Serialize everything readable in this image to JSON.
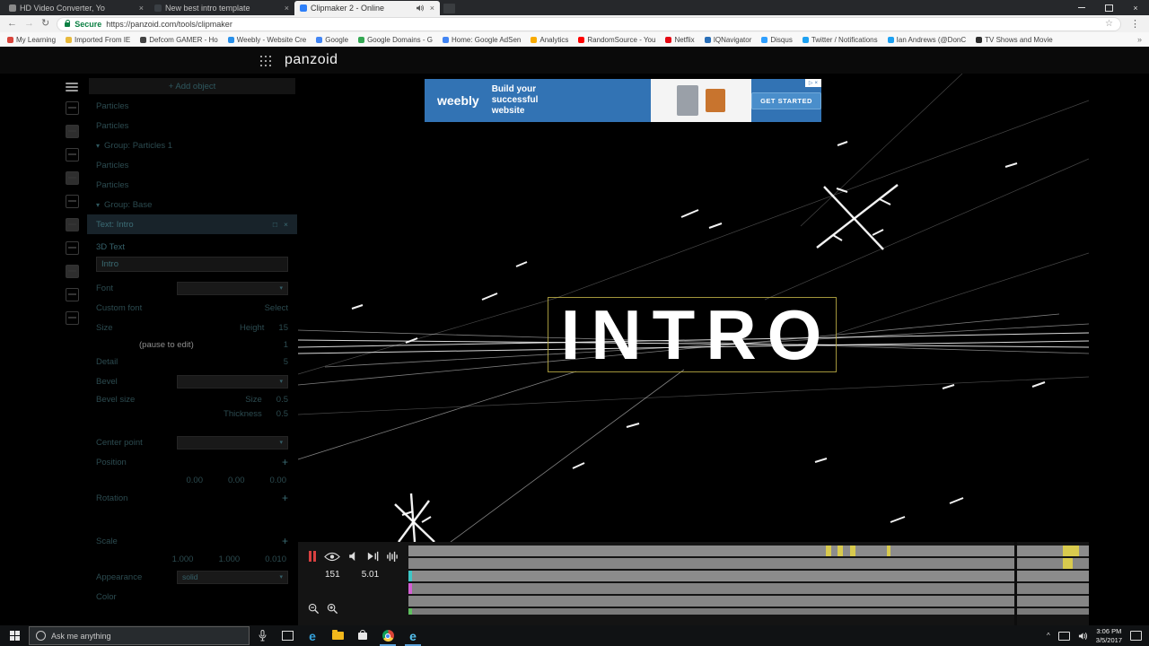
{
  "icons": {
    "close": "×",
    "star": "☆",
    "menu_dots": "⋮",
    "back": "←",
    "forward": "→",
    "refresh": "↻",
    "caret": "▾",
    "plus": "+",
    "overflow": "»",
    "chevron_up": "^",
    "dup": "□"
  },
  "browser": {
    "tabs": [
      {
        "title": "HD Video Converter, Yo"
      },
      {
        "title": "New best intro template"
      },
      {
        "title": "Clipmaker 2 - Online"
      }
    ],
    "address": {
      "secure_label": "Secure",
      "url": "https://panzoid.com/tools/clipmaker"
    },
    "bookmarks": [
      {
        "label": "My Learning",
        "color": "#d9453c"
      },
      {
        "label": "Imported From IE",
        "color": "#e8b93c"
      },
      {
        "label": "Defcom GAMER - Ho",
        "color": "#444444"
      },
      {
        "label": "Weebly - Website Cre",
        "color": "#2990ea"
      },
      {
        "label": "Google",
        "color": "#4285f4"
      },
      {
        "label": "Google Domains - G",
        "color": "#34a853"
      },
      {
        "label": "Home: Google AdSen",
        "color": "#4285f4"
      },
      {
        "label": "Analytics",
        "color": "#f9ab00"
      },
      {
        "label": "RandomSource - You",
        "color": "#ff0000"
      },
      {
        "label": "Netflix",
        "color": "#e50914"
      },
      {
        "label": "IQNavigator",
        "color": "#2a6fb8"
      },
      {
        "label": "Disqus",
        "color": "#2e9fff"
      },
      {
        "label": "Twitter / Notifications",
        "color": "#1da1f2"
      },
      {
        "label": "Ian Andrews (@DonC",
        "color": "#1da1f2"
      },
      {
        "label": "TV Shows and Movie",
        "color": "#2d2d2d"
      }
    ]
  },
  "app": {
    "header": {
      "logo": "panzoid"
    },
    "panel": {
      "add_object": "+ Add object",
      "tree": [
        "Particles",
        "Particles",
        "Group: Particles 1",
        "Particles",
        "Particles",
        "Group: Base",
        "Text: Intro"
      ],
      "props": {
        "section": "3D Text",
        "text_value": "Intro",
        "font_label": "Font",
        "font_value": "",
        "custom_font_label": "Custom font",
        "custom_font_value": "Select",
        "size_label": "Size",
        "height_label": "Height",
        "height_value": "15",
        "pause_hint": "(pause to edit)",
        "size_value2": "1",
        "detail_label": "Detail",
        "detail_value": "5",
        "bevel_label": "Bevel",
        "bevel_value": "",
        "bevel_size_label": "Bevel size",
        "bevel_size_sub": "Size",
        "bevel_size_value": "0.5",
        "thickness_label": "Thickness",
        "thickness_value": "0.5",
        "center_label": "Center point",
        "center_value": "",
        "position_label": "Position",
        "position_values": [
          "0.00",
          "0.00",
          "0.00"
        ],
        "rotation_label": "Rotation",
        "scale_label": "Scale",
        "scale_values": [
          "1.000",
          "1.000",
          "0.010"
        ],
        "appearance_label": "Appearance",
        "appearance_value": "solid",
        "color_label": "Color"
      }
    },
    "ad": {
      "brand": "weebly",
      "headline": "Build your successful website",
      "cta": "GET STARTED"
    },
    "preview": {
      "title": "INTRO"
    },
    "timeline": {
      "frame": "151",
      "time": "5.01"
    }
  },
  "taskbar": {
    "search_placeholder": "Ask me anything",
    "time": "3:06 PM",
    "date": "3/5/2017"
  }
}
